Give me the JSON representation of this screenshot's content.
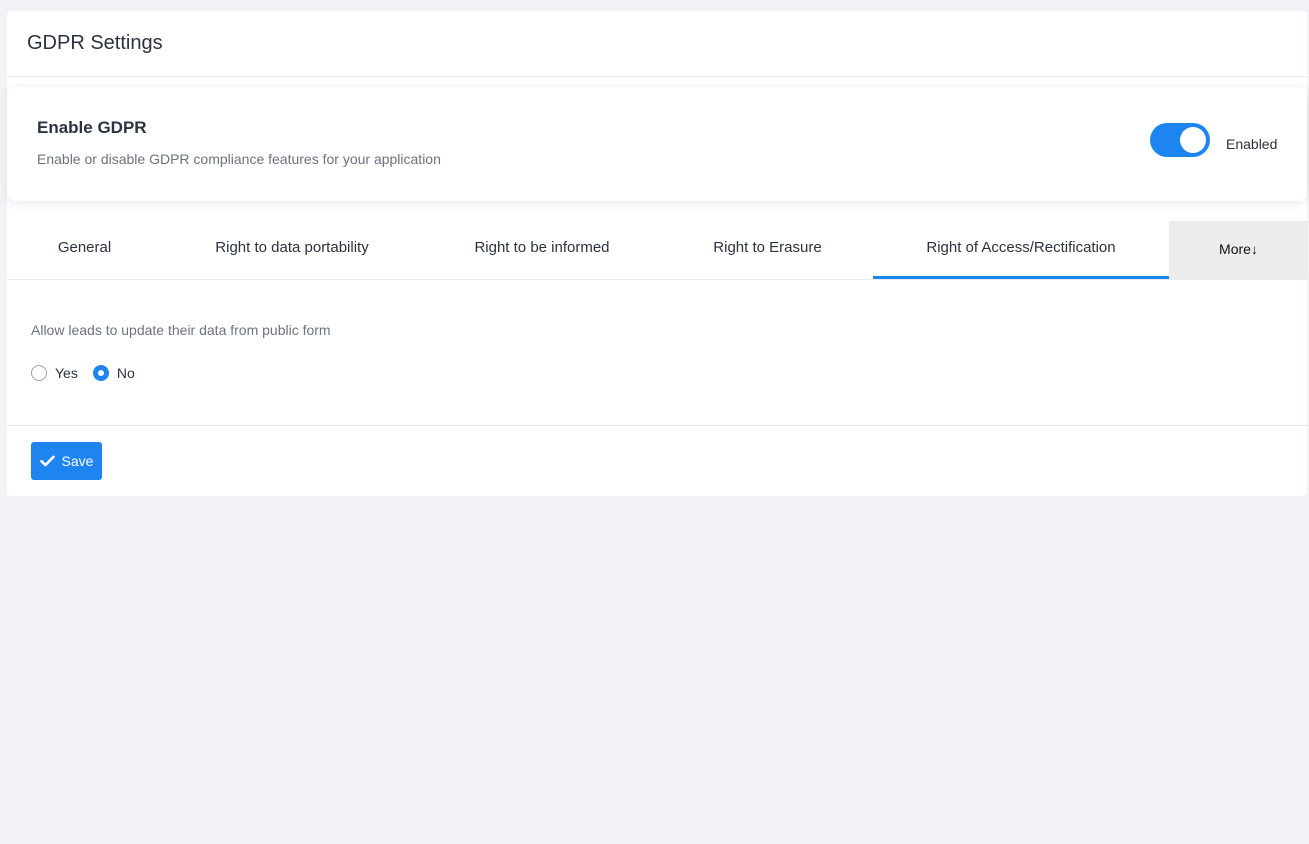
{
  "page": {
    "title": "GDPR Settings"
  },
  "gdpr_card": {
    "title": "Enable GDPR",
    "description": "Enable or disable GDPR compliance features for your application",
    "toggle_state": "Enabled",
    "toggle_on": true
  },
  "tabs": [
    {
      "label": "General",
      "active": false
    },
    {
      "label": "Right to data portability",
      "active": false
    },
    {
      "label": "Right to be informed",
      "active": false
    },
    {
      "label": "Right to Erasure",
      "active": false
    },
    {
      "label": "Right of Access/Rectification",
      "active": true
    }
  ],
  "more_tab": {
    "label": "More↓"
  },
  "setting": {
    "label": "Allow leads to update their data from public form",
    "options": [
      {
        "label": "Yes",
        "checked": false
      },
      {
        "label": "No",
        "checked": true
      }
    ]
  },
  "footer": {
    "save_label": "Save",
    "save_icon": "checkmark-icon"
  },
  "colors": {
    "accent": "#1e84f0",
    "background": "#f2f3f6",
    "more_tab_bg": "#ececec"
  }
}
